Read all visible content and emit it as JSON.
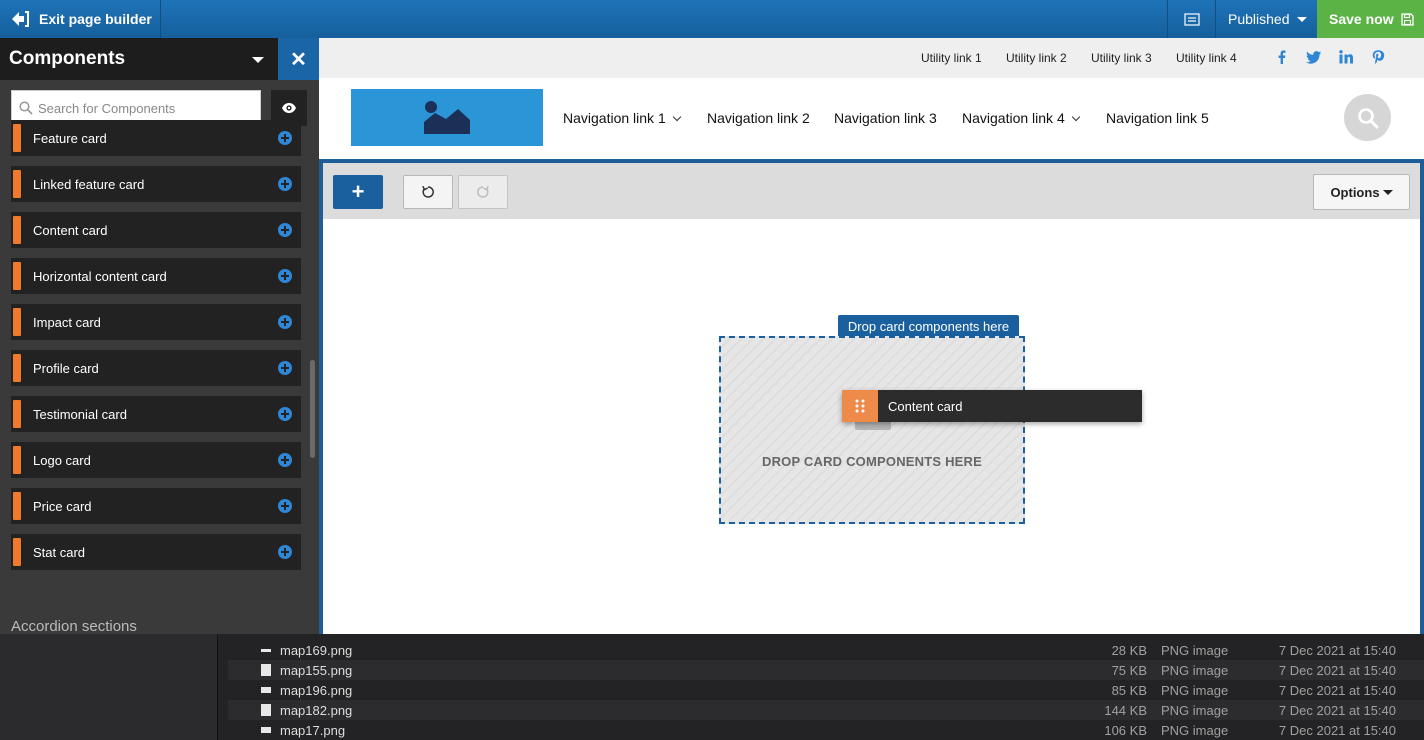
{
  "topbar": {
    "exit_label": "Exit page builder",
    "status_label": "Published",
    "save_label": "Save now"
  },
  "panel": {
    "title": "Components",
    "search_placeholder": "Search for Components",
    "items": [
      "Feature card",
      "Linked feature card",
      "Content card",
      "Horizontal content card",
      "Impact card",
      "Profile card",
      "Testimonial card",
      "Logo card",
      "Price card",
      "Stat card"
    ],
    "next_section": "Accordion sections"
  },
  "site": {
    "utility_links": [
      "Utility link 1",
      "Utility link 2",
      "Utility link 3",
      "Utility link 4"
    ],
    "social_icons": [
      "facebook-icon",
      "twitter-icon",
      "linkedin-icon",
      "pinterest-icon"
    ],
    "nav_links": [
      "Navigation link 1",
      "Navigation link 2",
      "Navigation link 3",
      "Navigation link 4",
      "Navigation link 5"
    ],
    "brand_color": "#1e73b8",
    "accent_color": "#f07a2b"
  },
  "builder": {
    "options_label": "Options",
    "drop_tag": "Drop card components here",
    "drop_text": "DROP CARD COMPONENTS HERE",
    "dragging_label": "Content card"
  },
  "finder": {
    "rows": [
      {
        "name": "map169.png",
        "size": "28 KB",
        "kind": "PNG image",
        "date": "7 Dec 2021 at 15:40"
      },
      {
        "name": "map155.png",
        "size": "75 KB",
        "kind": "PNG image",
        "date": "7 Dec 2021 at 15:40"
      },
      {
        "name": "map196.png",
        "size": "85 KB",
        "kind": "PNG image",
        "date": "7 Dec 2021 at 15:40"
      },
      {
        "name": "map182.png",
        "size": "144 KB",
        "kind": "PNG image",
        "date": "7 Dec 2021 at 15:40"
      },
      {
        "name": "map17.png",
        "size": "106 KB",
        "kind": "PNG image",
        "date": "7 Dec 2021 at 15:40"
      }
    ]
  }
}
